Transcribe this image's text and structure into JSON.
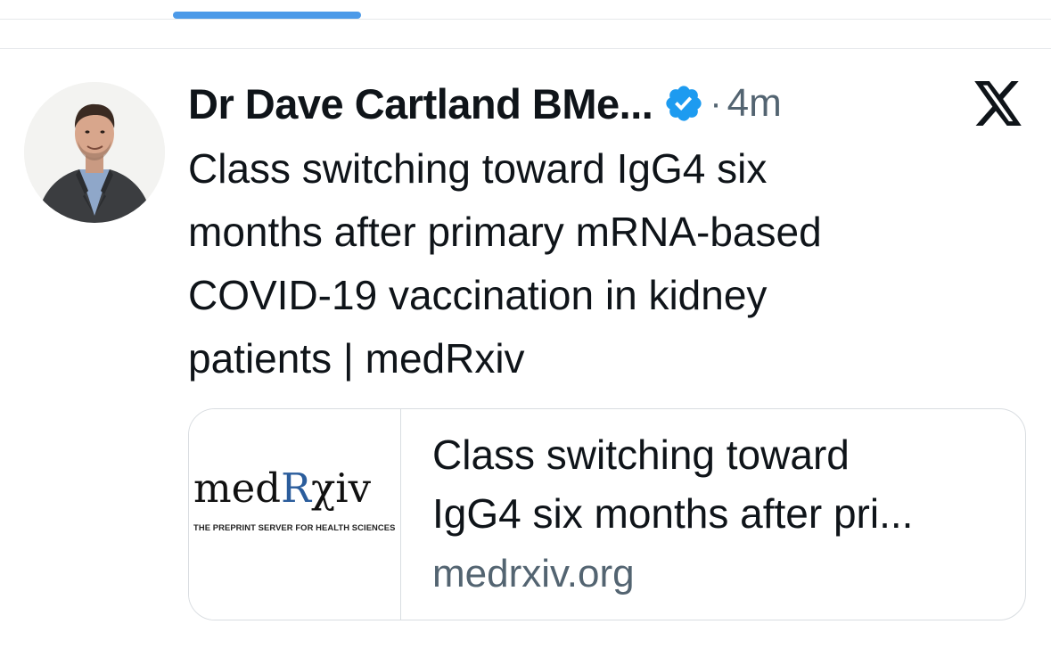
{
  "tweet": {
    "author_name": "Dr Dave Cartland BMe...",
    "separator": "·",
    "time_ago": "4m",
    "text_lines": [
      "Class switching toward IgG4 six",
      "months after primary mRNA-based",
      "COVID-19 vaccination in kidney",
      "patients | medRxiv"
    ]
  },
  "link_card": {
    "thumbnail": {
      "logo_prefix": "med",
      "logo_r": "R",
      "logo_suffix": "χiv",
      "tagline": "THE PREPRINT SERVER FOR HEALTH SCIENCES"
    },
    "title_lines": [
      "Class switching toward",
      "IgG4 six months after pri..."
    ],
    "domain": "medrxiv.org"
  },
  "colors": {
    "tab_indicator": "#4c9ae8",
    "verified_badge": "#1d9bf0",
    "secondary_text": "#536471",
    "primary_text": "#0f1419",
    "medrxiv_r": "#2b5d9c"
  },
  "icons": {
    "verified": "verified-badge-icon",
    "platform": "x-logo-icon"
  }
}
